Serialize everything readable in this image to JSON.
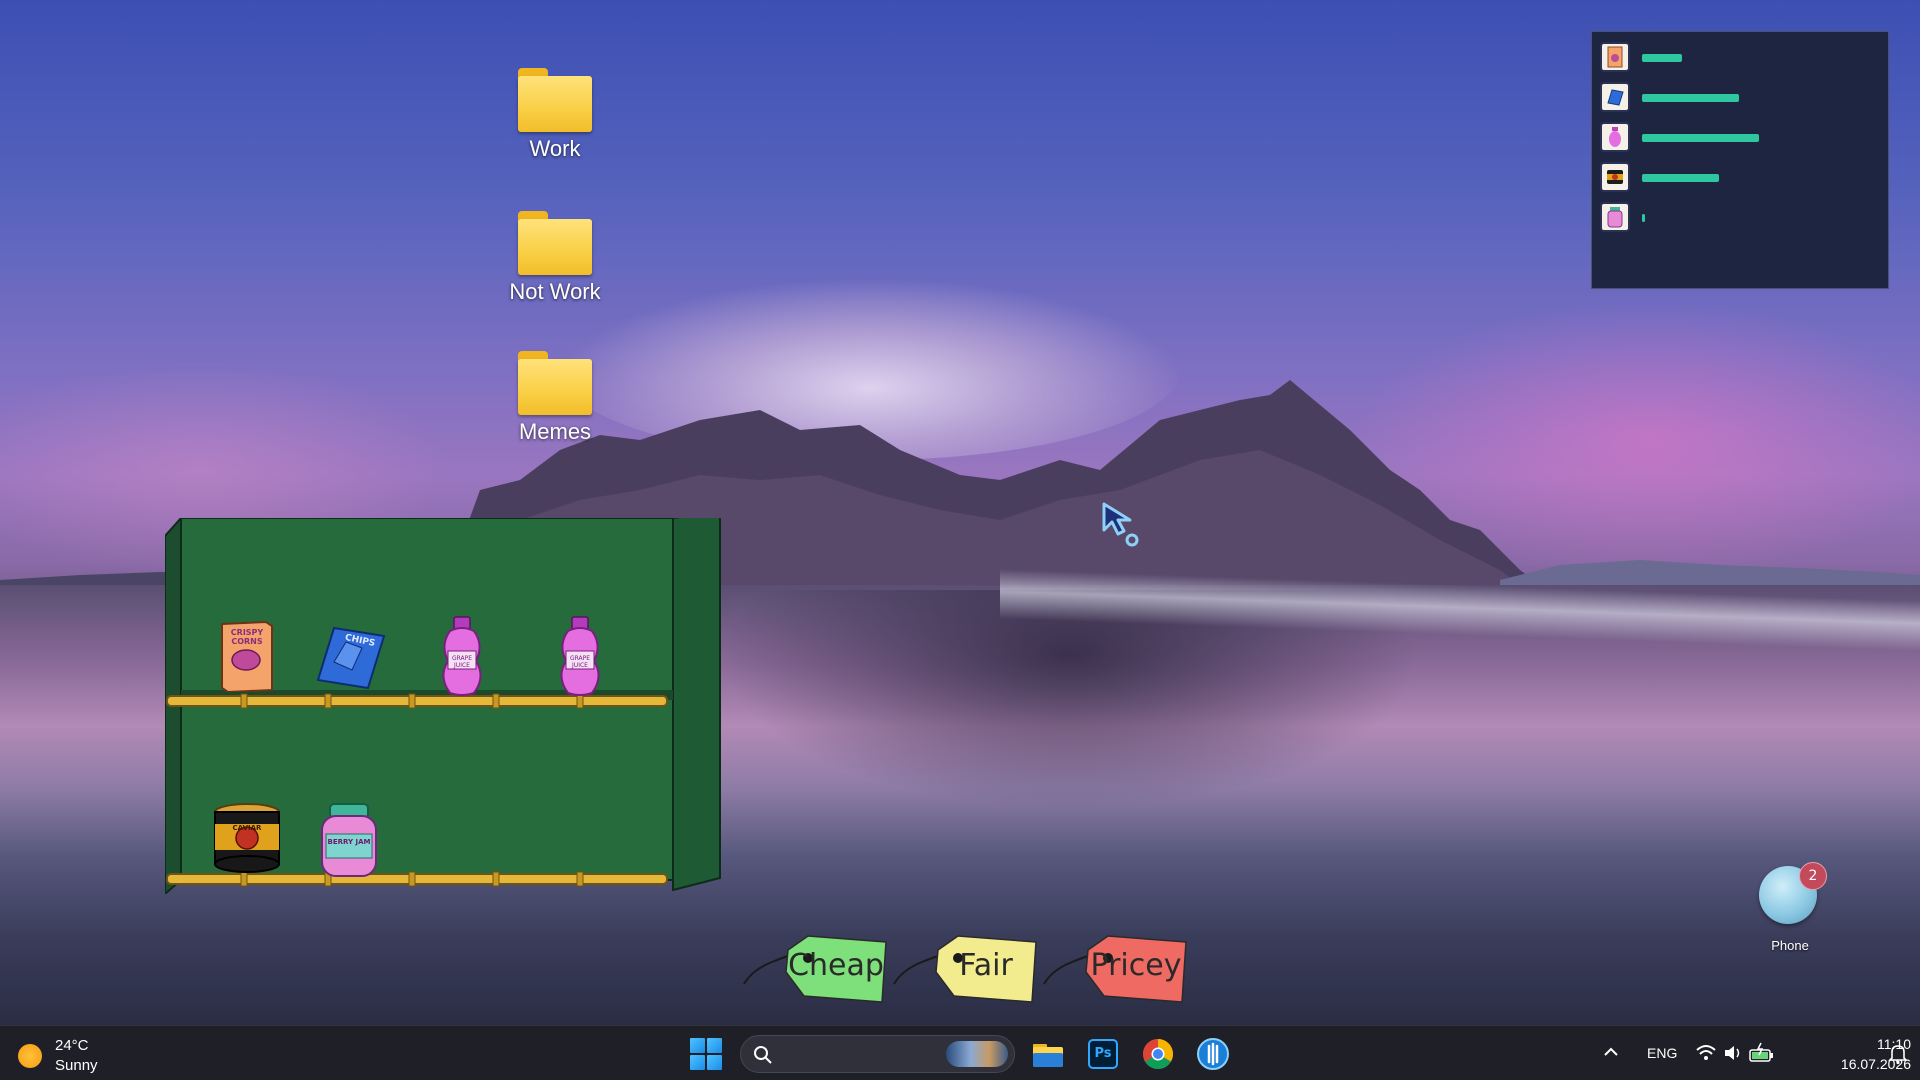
{
  "desktop_icons": [
    {
      "label": "Work",
      "icon": "folder-icon"
    },
    {
      "label": "Not Work",
      "icon": "folder-icon"
    },
    {
      "label": "Memes",
      "icon": "folder-icon"
    }
  ],
  "stats_panel": {
    "rows": [
      {
        "item": "cereal-box",
        "level": 0.18
      },
      {
        "item": "chips-bag",
        "level": 0.44
      },
      {
        "item": "soda-bottle",
        "level": 0.53
      },
      {
        "item": "canned-food",
        "level": 0.35
      },
      {
        "item": "jam-jar",
        "level": 0.01
      }
    ],
    "bar_color": "#2fc7a0"
  },
  "shelf": {
    "top_row": [
      {
        "item": "cereal-box",
        "label": "CRISPY CORNS"
      },
      {
        "item": "chips-bag",
        "label": "CHIPS"
      },
      {
        "item": "soda-bottle",
        "label": "GRAPE JUICE"
      },
      {
        "item": "soda-bottle",
        "label": "GRAPE JUICE"
      }
    ],
    "bottom_row": [
      {
        "item": "canned-food",
        "label": "CAVIAR"
      },
      {
        "item": "jam-jar",
        "label": "BERRY JAM"
      }
    ]
  },
  "price_tags": [
    {
      "label": "Cheap",
      "color": "#7ee07a"
    },
    {
      "label": "Fair",
      "color": "#f2ec8e"
    },
    {
      "label": "Pricey",
      "color": "#ef6a62"
    }
  ],
  "phone": {
    "label": "Phone",
    "badge": "2"
  },
  "taskbar": {
    "weather": {
      "temp": "24°C",
      "condition": "Sunny"
    },
    "apps": [
      "file-explorer-icon",
      "photoshop-icon",
      "chrome-icon",
      "app-icon"
    ],
    "photoshop_label": "Ps",
    "tray": {
      "language": "ENG",
      "time": "11:10",
      "date": "16.07.2026"
    }
  }
}
